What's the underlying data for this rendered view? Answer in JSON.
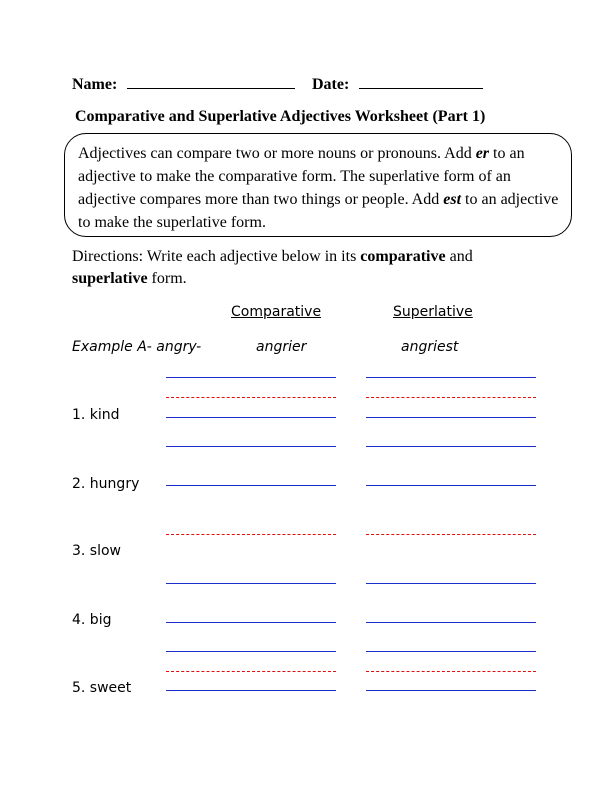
{
  "header": {
    "name_label": "Name:",
    "date_label": "Date:"
  },
  "title": "Comparative and Superlative Adjectives Worksheet (Part 1)",
  "info_box": {
    "part1": "Adjectives can compare two or more nouns or pronouns.  Add ",
    "suffix_er": "er",
    "part2": " to an adjective to make the comparative form. The superlative form of an adjective compares more than two things or people. Add ",
    "suffix_est": "est",
    "part3": " to an adjective to make the superlative form."
  },
  "directions": {
    "prefix": "Directions: Write each adjective below in its ",
    "bold1": "comparative",
    "middle": " and ",
    "bold2": "superlative",
    "suffix": " form."
  },
  "columns": {
    "comparative": "Comparative",
    "superlative": "Superlative"
  },
  "example": {
    "label": "Example A- angry-",
    "comparative": "angrier",
    "superlative": "angriest"
  },
  "items": [
    {
      "label": "1. kind"
    },
    {
      "label": "2. hungry"
    },
    {
      "label": "3. slow"
    },
    {
      "label": "4. big"
    },
    {
      "label": "5. sweet"
    }
  ],
  "colors": {
    "answer_line": "#1a2ecc",
    "guide_line": "#e01010"
  }
}
